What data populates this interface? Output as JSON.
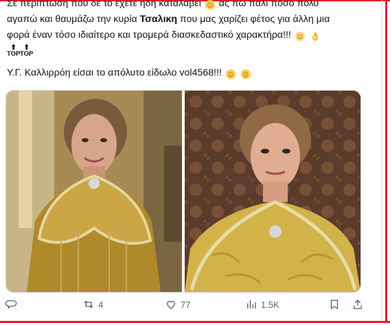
{
  "post": {
    "line1": "Σε περίπτωση που δε το έχετε ήδη καταλάβει",
    "line1_after": "ας πω πάλι πόσο πολύ",
    "line2_before": "αγαπώ και θαυμάζω την κυρία",
    "line2_bold": "Τσαλικη",
    "line2_after": "που μας χαρίζει φέτος για άλλη μια",
    "line3": "φορά έναν τόσο ιδιαίτερο και τρομερά διασκεδαστικό χαρακτήρα!!!",
    "top_badge_1": "TOP",
    "top_badge_2": "TOP",
    "line4": "Υ.Γ. Καλλιρρόη είσαι το απόλυτο είδωλο vol4568!!!"
  },
  "emojis": {
    "hand_over_mouth": "face-with-hand-over-mouth-emoji",
    "hugging": "hugging-face-emoji",
    "ok_hand": "ok-hand-emoji"
  },
  "media": {
    "photos": [
      "woman-in-gold-cape-photo-left",
      "woman-in-gold-cape-photo-right"
    ]
  },
  "actions": {
    "reply_count": "",
    "retweet_count": "4",
    "like_count": "77",
    "views_count": "1.5K"
  },
  "colors": {
    "frame": "#e0202a",
    "text": "#0f1419",
    "muted": "#536471",
    "cape_gold": "#c9a53e"
  }
}
